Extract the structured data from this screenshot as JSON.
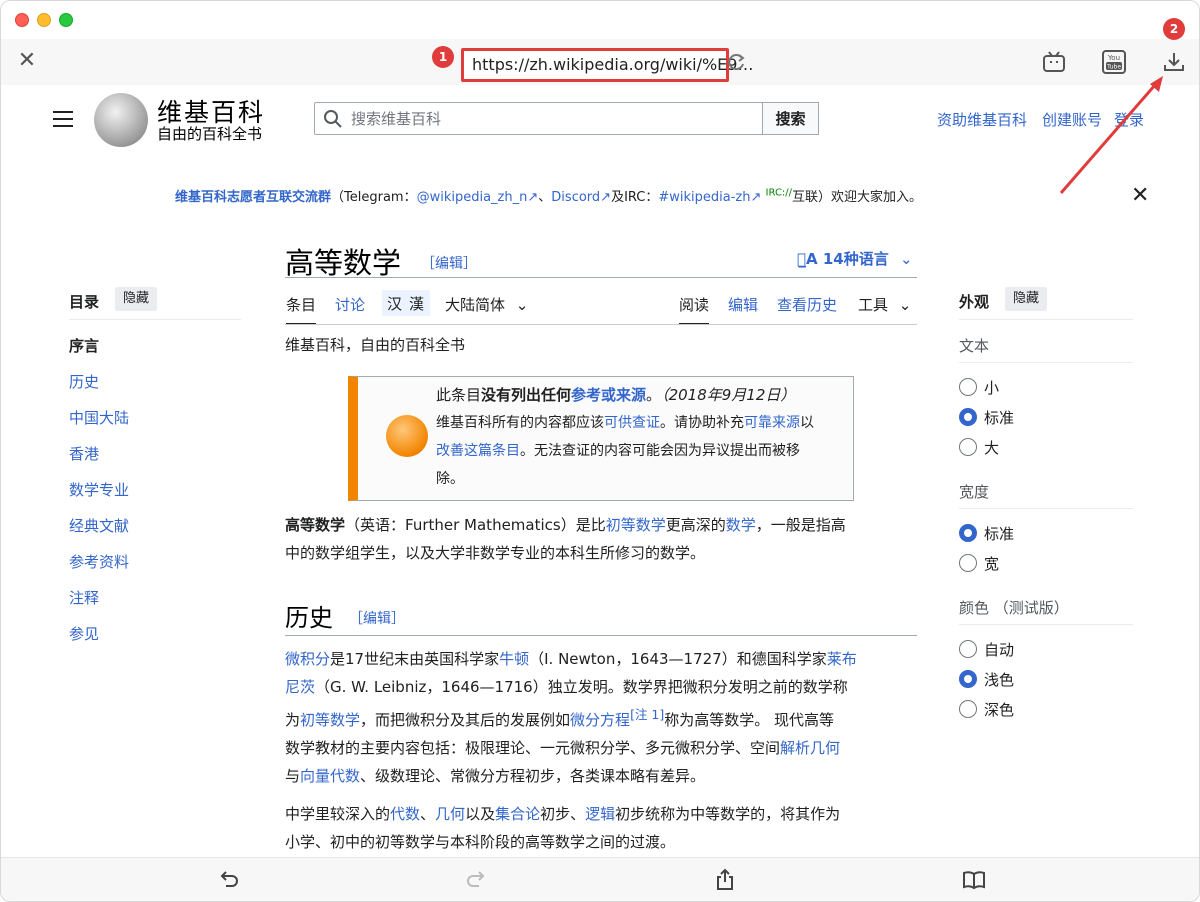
{
  "browser": {
    "url": "https://zh.wikipedia.org/wiki/%E9…",
    "badges": [
      "1",
      "2"
    ],
    "toolbar_icons": [
      "close-icon",
      "reload-icon",
      "bilibili-icon",
      "youtube-icon",
      "download-icon"
    ],
    "bottom_icons": [
      "undo-icon",
      "redo-icon",
      "share-icon",
      "book-icon"
    ],
    "accent_color": "#e03c3c"
  },
  "header": {
    "wordmark": "维基百科",
    "tagline": "自由的百科全书",
    "search_placeholder": "搜索维基百科",
    "search_button": "搜索",
    "links": [
      "资助维基百科",
      "创建账号",
      "登录"
    ]
  },
  "sitenotice": {
    "group": "维基百科志愿者互联交流群",
    "open_paren": "（Telegram：",
    "telegram": "@wikipedia_zh_n",
    "sep1": "、",
    "discord": "Discord",
    "and_irc": "及IRC：",
    "irc": "#wikipedia-zh",
    "irc_sup": "IRC://",
    "tail": "互联）欢迎大家加入。"
  },
  "toc": {
    "title": "目录",
    "hide": "隐藏",
    "items": [
      "序言",
      "历史",
      "中国大陆",
      "香港",
      "数学专业",
      "经典文献",
      "参考资料",
      "注释",
      "参见"
    ]
  },
  "article": {
    "title": "高等数学",
    "edit": "［编辑］",
    "languages": "14种语言",
    "tabs": {
      "article": "条目",
      "talk": "讨论",
      "han1": "汉",
      "han2": "漢",
      "variant": "大陆简体",
      "read": "阅读",
      "edit": "编辑",
      "history": "查看历史",
      "tools": "工具"
    },
    "subtitle": "维基百科，自由的百科全书",
    "ambox": {
      "l1a": "此条目",
      "l1b": "没有列出任何",
      "l1c": "参考或来源",
      "l1d": "。",
      "l1e": "（2018年9月12日）",
      "l2a": "维基百科所有的内容都应该",
      "l2b": "可供查证",
      "l2c": "。请协助补充",
      "l2d": "可靠来源",
      "l2e": "以",
      "l3a": "改善这篇条目",
      "l3b": "。无法查证的内容可能会因为异议提出而被移",
      "l4": "除。"
    },
    "intro": {
      "a": "高等数学",
      "b": "（英语：Further Mathematics）是比",
      "c": "初等数学",
      "d": "更高深的",
      "e": "数学",
      "f": "，一般是指高",
      "g": "中的数学组学生，以及大学非数学专业的本科生所修习的数学。"
    },
    "history_heading": "历史",
    "history_edit": "［编辑］",
    "p1": {
      "a": "微积分",
      "b": "是17世纪末由英国科学家",
      "c": "牛顿",
      "d": "（I. Newton，1643—1727）和德国科学家",
      "e": "莱布",
      "f": "尼茨",
      "g": "（G. W. Leibniz，1646—1716）独立发明。数学界把微积分发明之前的数学称",
      "h": "为",
      "i": "初等数学",
      "j": "，而把微积分及其后的发展例如",
      "k": "微分方程",
      "l": "[注 1]",
      "m": "称为高等数学。 现代高等",
      "n": "数学教材的主要内容包括：极限理论、一元微积分学、多元微积分学、空间",
      "o": "解析几何",
      "p": "与",
      "q": "向量代数",
      "r": "、级数理论、常微分方程初步，各类课本略有差异。"
    },
    "p2": {
      "a": "中学里较深入的",
      "b": "代数",
      "c": "、",
      "d": "几何",
      "e": "以及",
      "f": "集合论",
      "g": "初步、",
      "h": "逻辑",
      "i": "初步统称为中等数学的，将其作为",
      "j": "小学、初中的初等数学与本科阶段的高等数学之间的过渡。"
    }
  },
  "appearance": {
    "title": "外观",
    "hide": "隐藏",
    "text_label": "文本",
    "text_options": [
      "小",
      "标准",
      "大"
    ],
    "text_selected": 1,
    "width_label": "宽度",
    "width_options": [
      "标准",
      "宽"
    ],
    "width_selected": 0,
    "color_label": "颜色",
    "color_label_note": "（测试版）",
    "color_options": [
      "自动",
      "浅色",
      "深色"
    ],
    "color_selected": 1
  }
}
